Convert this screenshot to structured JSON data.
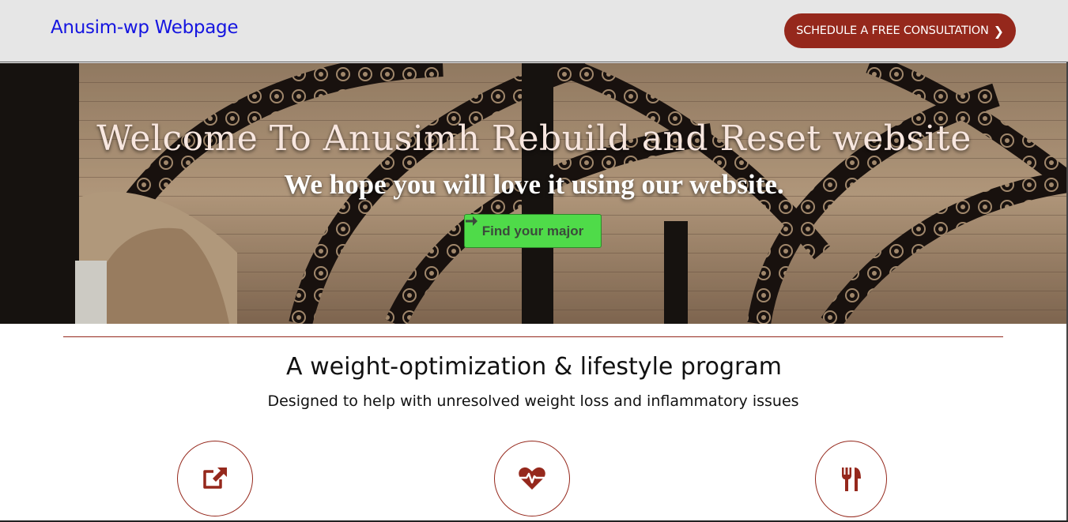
{
  "header": {
    "brand": "Anusim-wp Webpage",
    "cta_label": "SCHEDULE A FREE CONSULTATION",
    "cta_icon": "chevron-right-icon"
  },
  "hero": {
    "title": "Welcome To Anusimh Rebuild and Reset website",
    "subtitle": "We hope you will love it using our website.",
    "button_label": "Find your major",
    "button_icon": "arrow-right-icon"
  },
  "program": {
    "title": "A weight-optimization & lifestyle program",
    "subtitle": "Designed to help with unresolved weight loss and inflammatory issues",
    "features": [
      {
        "icon": "external-link-icon"
      },
      {
        "icon": "heartbeat-icon"
      },
      {
        "icon": "utensils-icon"
      }
    ]
  },
  "colors": {
    "brand_blue": "#1515e0",
    "accent_red": "#95281c",
    "cta_green": "#4fdb49",
    "header_bg": "#e6e6e6"
  }
}
